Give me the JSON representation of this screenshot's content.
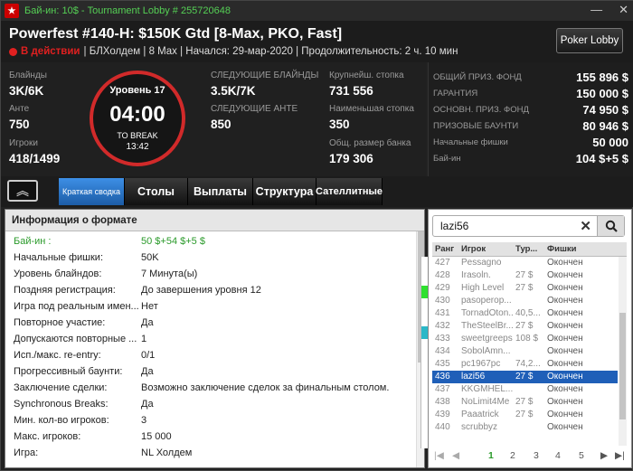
{
  "window": {
    "title": "Бай-ин: 10$ - Tournament Lobby # 255720648",
    "controls": [
      "—",
      "✕"
    ]
  },
  "header": {
    "name": "Powerfest #140-H: $150K Gtd [8-Max, PKO, Fast]",
    "status": "В действии",
    "info": "| БЛХолдем | 8 Max | Начался: 29-мар-2020 | Продолжительность: 2 ч. 10 мин",
    "lobby_button": "Poker Lobby"
  },
  "stats": {
    "blinds_label": "Блайнды",
    "blinds": "3K/6K",
    "ante_label": "Анте",
    "ante": "750",
    "players_label": "Игроки",
    "players": "418/1499",
    "next_blinds_label": "СЛЕДУЮЩИЕ БЛАЙНДЫ",
    "next_blinds": "3.5K/7K",
    "next_ante_label": "СЛЕДУЮЩИЕ АНТЕ",
    "next_ante": "850",
    "biggest_label": "Крупнейш. стопка",
    "biggest": "731 556",
    "smallest_label": "Наименьшая стопка",
    "smallest": "350",
    "total_label": "Общ. размер банка",
    "total": "179 306"
  },
  "clock": {
    "level": "Уровень 17",
    "time": "04:00",
    "to_break_label": "TO BREAK",
    "to_break": "13:42"
  },
  "prize": [
    {
      "label": "ОБЩИЙ ПРИЗ. ФОНД",
      "value": "155 896 $"
    },
    {
      "label": "ГАРАНТИЯ",
      "value": "150 000 $"
    },
    {
      "label": "ОСНОВН. ПРИЗ. ФОНД",
      "value": "74 950 $"
    },
    {
      "label": "ПРИЗОВЫЕ БАУНТИ",
      "value": "80 946 $"
    },
    {
      "label": "Начальные фишки",
      "value": "50 000"
    },
    {
      "label": "Бай-ин",
      "value": "104 $+5 $"
    }
  ],
  "tabs": {
    "collapse": "︽",
    "summary": "Краткая сводка",
    "tables": "Столы",
    "payouts": "Выплаты",
    "structure": "Структура",
    "satellites": "Сателлитные"
  },
  "info": {
    "title": "Информация о формате",
    "rows": [
      {
        "k": "Бай-ин :",
        "v": "50 $+54 $+5 $"
      },
      {
        "k": "Начальные фишки:",
        "v": "50K"
      },
      {
        "k": "Уровень блайндов:",
        "v": "7 Минута(ы)"
      },
      {
        "k": "Поздняя регистрация:",
        "v": "До завершения уровня 12"
      },
      {
        "k": "Игра под реальным имен...",
        "v": "Нет"
      },
      {
        "k": "Повторное участие:",
        "v": "Да"
      },
      {
        "k": "Допускаются повторные ...",
        "v": "1"
      },
      {
        "k": "Исп./макс. re-entry:",
        "v": "0/1"
      },
      {
        "k": "Прогрессивный баунти:",
        "v": "Да"
      },
      {
        "k": "Заключение сделки:",
        "v": "Возможно заключение сделок за финальным столом."
      },
      {
        "k": "Synchronous Breaks:",
        "v": "Да"
      },
      {
        "k": "Мин. кол-во игроков:",
        "v": "3"
      },
      {
        "k": "Макс. игроков:",
        "v": "15 000"
      },
      {
        "k": "Игра:",
        "v": "NL Холдем"
      }
    ]
  },
  "players": {
    "search": "lazi56",
    "headers": {
      "rank": "Ранг",
      "name": "Игрок",
      "tour": "Тур...",
      "chips": "Фишки"
    },
    "rows": [
      {
        "r": "427",
        "n": "Pessagno",
        "t": "",
        "c": "Окончен"
      },
      {
        "r": "428",
        "n": "Irasoln.",
        "t": "27 $",
        "c": "Окончен"
      },
      {
        "r": "429",
        "n": "High Level",
        "t": "27 $",
        "c": "Окончен"
      },
      {
        "r": "430",
        "n": "pasoperop...",
        "t": "",
        "c": "Окончен"
      },
      {
        "r": "431",
        "n": "TornadOton...",
        "t": "40,5...",
        "c": "Окончен"
      },
      {
        "r": "432",
        "n": "TheSteelBr...",
        "t": "27 $",
        "c": "Окончен"
      },
      {
        "r": "433",
        "n": "sweetgreeps",
        "t": "108 $",
        "c": "Окончен"
      },
      {
        "r": "434",
        "n": "SobolAmn...",
        "t": "",
        "c": "Окончен"
      },
      {
        "r": "435",
        "n": "pc1967pc",
        "t": "74,2...",
        "c": "Окончен"
      },
      {
        "r": "436",
        "n": "lazi56",
        "t": "27 $",
        "c": "Окончен"
      },
      {
        "r": "437",
        "n": "KKGMHEL...",
        "t": "",
        "c": "Окончен"
      },
      {
        "r": "438",
        "n": "NoLimit4Me",
        "t": "27 $",
        "c": "Окончен"
      },
      {
        "r": "439",
        "n": "Paaatrick",
        "t": "27 $",
        "c": "Окончен"
      },
      {
        "r": "440",
        "n": "scrubbyz",
        "t": "",
        "c": "Окончен"
      }
    ],
    "pages": [
      "1",
      "2",
      "3",
      "4",
      "5"
    ]
  }
}
